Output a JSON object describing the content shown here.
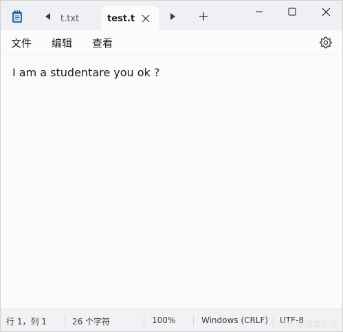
{
  "tabs": [
    {
      "label": "t.txt",
      "active": false
    },
    {
      "label": "test.t",
      "active": true
    }
  ],
  "menu": {
    "file": "文件",
    "edit": "编辑",
    "view": "查看"
  },
  "editor": {
    "content": "I am a studentare you ok ?"
  },
  "status": {
    "position": "行 1，列 1",
    "chars": "26 个字符",
    "zoom": "100%",
    "line_ending": "Windows (CRLF)",
    "encoding": "UTF-8"
  },
  "watermark": "CSDN @流星白龙",
  "icons": {
    "app": "notepad-icon",
    "tab_left": "caret-left-icon",
    "tab_right": "caret-right-icon",
    "close_tab": "close-icon",
    "new_tab": "plus-icon",
    "minimize": "minimize-icon",
    "maximize": "maximize-icon",
    "close_window": "close-icon",
    "settings": "gear-icon"
  },
  "colors": {
    "titlebar": "#eef0f4",
    "content": "#fbfbfb",
    "statusbar": "#f1f2f5",
    "app_icon": "#1a73c8"
  }
}
